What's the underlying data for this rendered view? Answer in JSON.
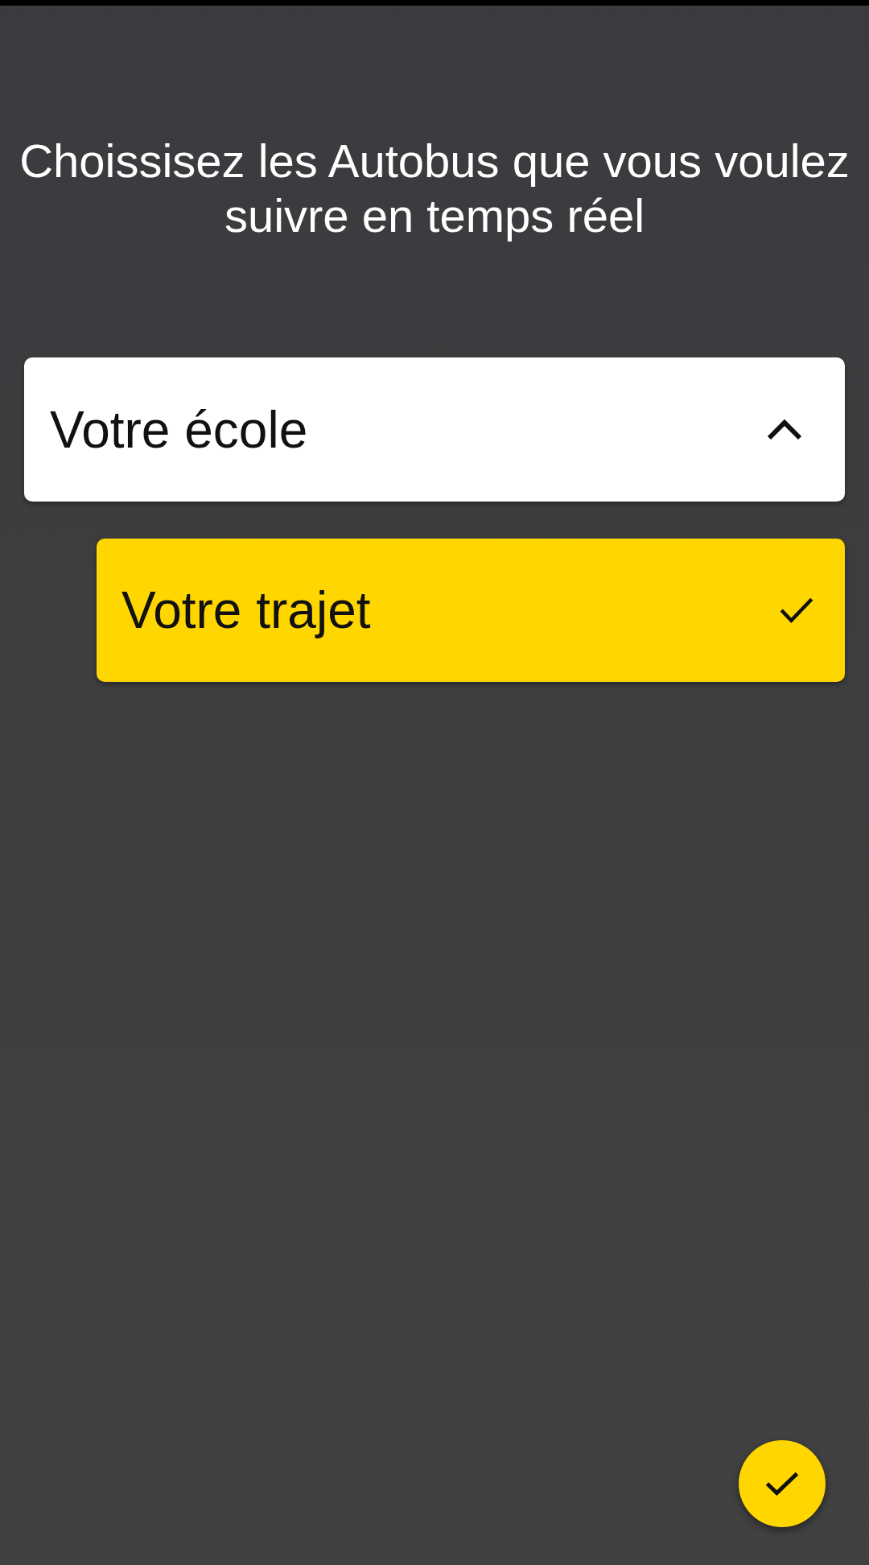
{
  "title": "Choissisez les Autobus que vous voulez suivre en temps réel",
  "groups": [
    {
      "label": "Votre école",
      "expanded": true,
      "children": [
        {
          "label": "Votre trajet",
          "selected": true
        }
      ]
    }
  ]
}
